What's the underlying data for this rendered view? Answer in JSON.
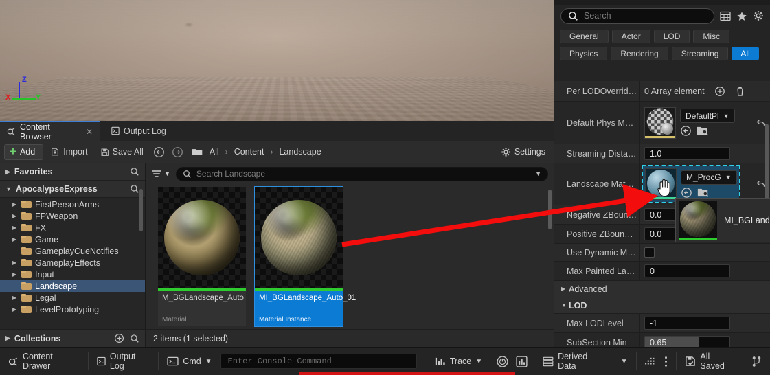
{
  "viewport": {
    "gizmo": {
      "x_label": "X",
      "y_label": "Y",
      "z_label": "Z",
      "x_color": "#e01b1b",
      "y_color": "#26c426",
      "z_color": "#2b2bdd"
    }
  },
  "panel_tabs": [
    {
      "label": "Content Browser",
      "icon": "content-browser-icon",
      "active": true,
      "closable": true
    },
    {
      "label": "Output Log",
      "icon": "output-log-icon",
      "active": false,
      "closable": false
    }
  ],
  "content_browser": {
    "toolbar": {
      "add_label": "Add",
      "import_label": "Import",
      "save_all_label": "Save All",
      "settings_label": "Settings",
      "back_icon": "arrow-back-icon",
      "forward_icon": "arrow-forward-icon"
    },
    "breadcrumb": {
      "folder_icon": "folder-icon",
      "items": [
        "All",
        "Content",
        "Landscape"
      ],
      "separator": "›"
    },
    "sources": {
      "favorites_label": "Favorites",
      "project_label": "ApocalypseExpress",
      "tree": [
        {
          "label": "FirstPersonArms",
          "expandable": true,
          "selected": false
        },
        {
          "label": "FPWeapon",
          "expandable": true,
          "selected": false
        },
        {
          "label": "FX",
          "expandable": true,
          "selected": false
        },
        {
          "label": "Game",
          "expandable": true,
          "selected": false
        },
        {
          "label": "GameplayCueNotifies",
          "expandable": false,
          "selected": false
        },
        {
          "label": "GameplayEffects",
          "expandable": true,
          "selected": false
        },
        {
          "label": "Input",
          "expandable": true,
          "selected": false
        },
        {
          "label": "Landscape",
          "expandable": false,
          "selected": true
        },
        {
          "label": "Legal",
          "expandable": true,
          "selected": false
        },
        {
          "label": "LevelPrototyping",
          "expandable": true,
          "selected": false
        }
      ],
      "collections_label": "Collections"
    },
    "search": {
      "placeholder": "Search Landscape",
      "value": ""
    },
    "assets": [
      {
        "name": "M_BGLandscape_Auto",
        "type": "Material",
        "selected": false,
        "type_color": "#2ecc2e"
      },
      {
        "name": "MI_BGLandscape_Auto_01",
        "type": "Material Instance",
        "selected": true,
        "type_color": "#2ecc2e"
      }
    ],
    "status": "2 items (1 selected)"
  },
  "details": {
    "search": {
      "placeholder": "Search",
      "value": ""
    },
    "header_icons": [
      "grid-icon",
      "star-icon",
      "gear-icon"
    ],
    "filter_chips": [
      {
        "label": "General",
        "active": false
      },
      {
        "label": "Actor",
        "active": false
      },
      {
        "label": "LOD",
        "active": false
      },
      {
        "label": "Misc",
        "active": false
      },
      {
        "label": "Physics",
        "active": false
      },
      {
        "label": "Rendering",
        "active": false
      },
      {
        "label": "Streaming",
        "active": false
      },
      {
        "label": "All",
        "active": true
      }
    ],
    "properties": [
      {
        "kind": "array",
        "label": "Per LODOverrid…",
        "value": "0 Array element",
        "add_icon": "add-circle-icon",
        "delete_icon": "trash-icon"
      },
      {
        "kind": "asset",
        "label": "Default Phys M…",
        "value": "DefaultPl",
        "browse_icon": "browse-icon",
        "locate_icon": "locate-icon",
        "reset_icon": "reset-arrow-icon"
      },
      {
        "kind": "text",
        "label": "Streaming Dista…",
        "value": "1.0"
      },
      {
        "kind": "asset-drop",
        "label": "Landscape Mat…",
        "value": "M_ProcG",
        "browse_icon": "browse-icon",
        "locate_icon": "locate-icon",
        "reset_icon": "reset-arrow-icon"
      },
      {
        "kind": "text",
        "label": "Negative ZBoun…",
        "value": "0.0"
      },
      {
        "kind": "text",
        "label": "Positive ZBoun…",
        "value": "0.0"
      },
      {
        "kind": "check",
        "label": "Use Dynamic M…",
        "value": ""
      },
      {
        "kind": "text",
        "label": "Max Painted La…",
        "value": "0"
      },
      {
        "kind": "section",
        "label": "Advanced",
        "expanded": false
      },
      {
        "kind": "section",
        "label": "LOD",
        "expanded": true
      },
      {
        "kind": "text",
        "label": "Max LODLevel",
        "value": "-1"
      },
      {
        "kind": "text",
        "label": "SubSection Min",
        "value": "0.65"
      }
    ]
  },
  "drag_tooltip": {
    "name": "MI_BGLand",
    "thumb_icon": "material-sphere-icon"
  },
  "cursor": {
    "icon": "drag-hand-cursor"
  },
  "annotation": {
    "arrow_color": "#f30d0d",
    "underline_color": "#d31515"
  },
  "bottom_bar": {
    "content_drawer": "Content Drawer",
    "output_log": "Output Log",
    "cmd_label": "Cmd",
    "console_placeholder": "Enter Console Command",
    "trace_label": "Trace",
    "derived_data_label": "Derived Data",
    "all_saved_label": "All Saved",
    "icons": [
      "content-drawer-icon",
      "output-log-icon",
      "console-icon",
      "trace-icon",
      "perf-record-icon",
      "perf-chart-icon",
      "derived-data-icon",
      "grid-dots-icon",
      "kebab-icon",
      "save-icon",
      "source-control-icon"
    ]
  }
}
